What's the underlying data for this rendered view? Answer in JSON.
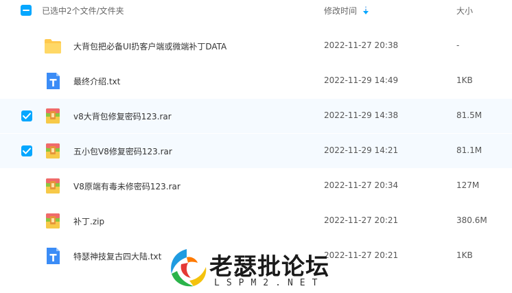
{
  "header": {
    "selection_label": "已选中2个文件/文件夹",
    "modified_label": "修改时间",
    "size_label": "大小"
  },
  "files": [
    {
      "name": "大背包把必备UI扔客户端或微端补丁DATA",
      "modified": "2022-11-27 20:38",
      "size": "-",
      "type": "folder",
      "selected": false
    },
    {
      "name": "最终介绍.txt",
      "modified": "2022-11-29 14:49",
      "size": "1KB",
      "type": "txt",
      "selected": false
    },
    {
      "name": "v8大背包修复密码123.rar",
      "modified": "2022-11-29 14:38",
      "size": "81.5M",
      "type": "archive",
      "selected": true
    },
    {
      "name": "五小包V8修复密码123.rar",
      "modified": "2022-11-29 14:21",
      "size": "81.1M",
      "type": "archive",
      "selected": true
    },
    {
      "name": "V8原端有毒未修密码123.rar",
      "modified": "2022-11-27 20:34",
      "size": "127M",
      "type": "archive",
      "selected": false
    },
    {
      "name": "补丁.zip",
      "modified": "2022-11-27 20:21",
      "size": "380.6M",
      "type": "archive",
      "selected": false
    },
    {
      "name": "特瑟神技复古四大陆.txt",
      "modified": "2022-11-27 20:21",
      "size": "1KB",
      "type": "txt",
      "selected": false
    }
  ],
  "watermark": {
    "title": "老瑟批论坛",
    "domain": "LSPM2.NET"
  },
  "colors": {
    "accent": "#06a7ff",
    "selected_row": "#f5faff",
    "folder": "#ffc94d",
    "txt": "#3b8cf6"
  }
}
